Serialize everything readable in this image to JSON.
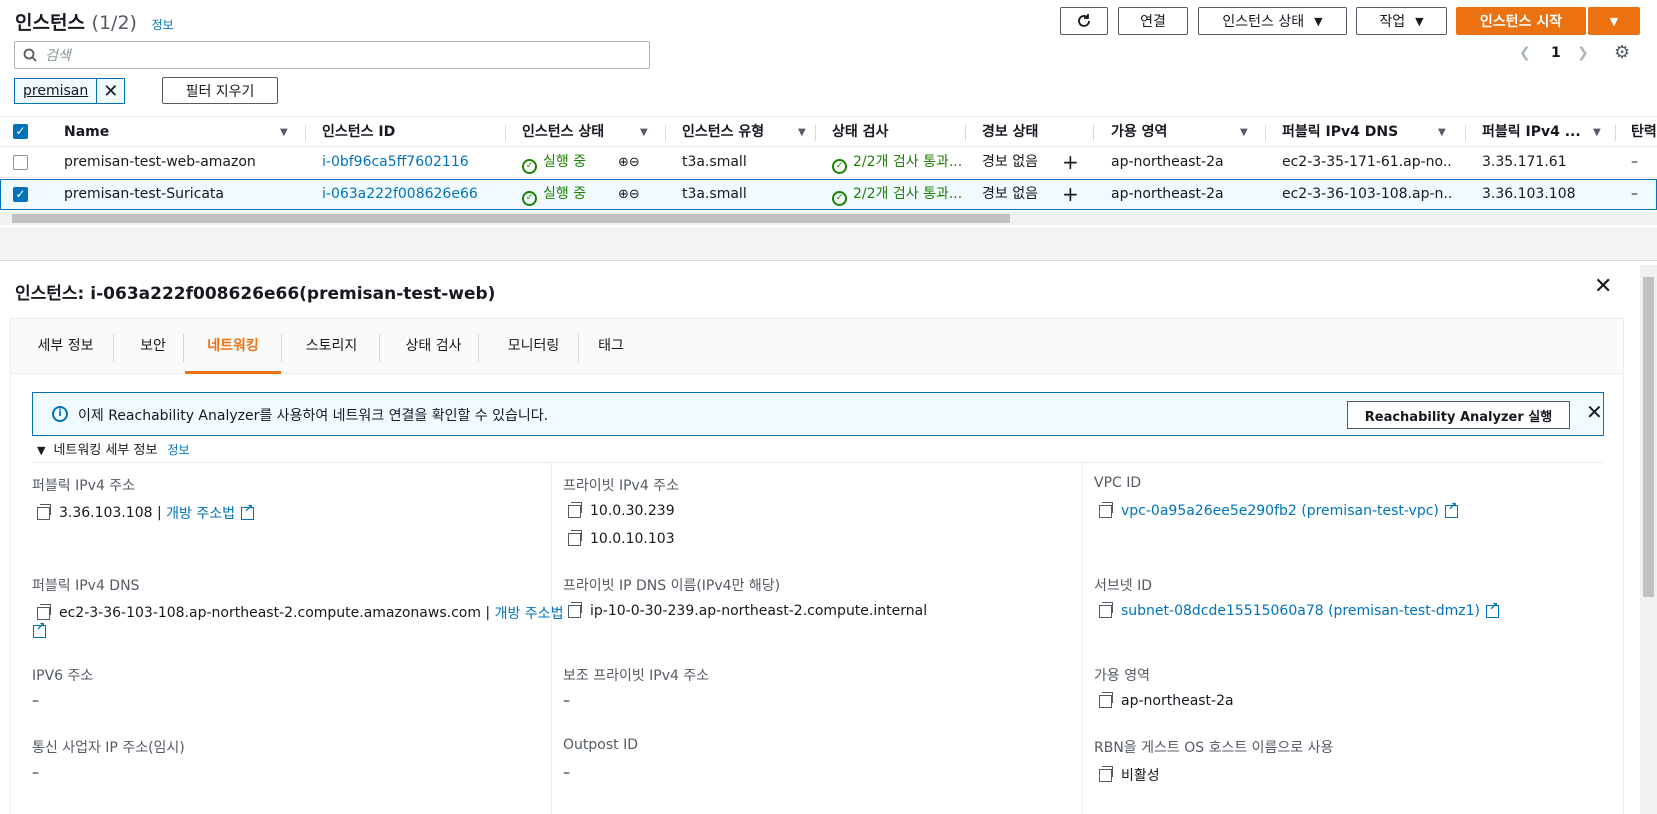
{
  "header": {
    "title": "인스턴스",
    "count": "(1/2)",
    "info": "정보",
    "buttons": {
      "connect": "연결",
      "instance_state": "인스턴스 상태",
      "actions": "작업",
      "launch": "인스턴스 시작"
    },
    "search_placeholder": "검색",
    "filter_token": "premisan",
    "clear_filters": "필터 지우기",
    "page": "1"
  },
  "table": {
    "columns": [
      "Name",
      "인스턴스 ID",
      "인스턴스 상태",
      "인스턴스 유형",
      "상태 검사",
      "경보 상태",
      "가용 영역",
      "퍼블릭 IPv4 DNS",
      "퍼블릭 IPv4 ...",
      "탄력"
    ],
    "rows": [
      {
        "selected": false,
        "name": "premisan-test-web-amazon",
        "id": "i-0bf96ca5ff7602116",
        "state": "실행 중",
        "type": "t3a.small",
        "check": "2/2개 검사 통과...",
        "alarm": "경보 없음",
        "az": "ap-northeast-2a",
        "dns": "ec2-3-35-171-61.ap-no...",
        "ip": "3.35.171.61",
        "elastic": "–"
      },
      {
        "selected": true,
        "name": "premisan-test-Suricata",
        "id": "i-063a222f008626e66",
        "state": "실행 중",
        "type": "t3a.small",
        "check": "2/2개 검사 통과...",
        "alarm": "경보 없음",
        "az": "ap-northeast-2a",
        "dns": "ec2-3-36-103-108.ap-n...",
        "ip": "3.36.103.108",
        "elastic": "–"
      }
    ]
  },
  "detail": {
    "title": "인스턴스: i-063a222f008626e66(premisan-test-web)",
    "tabs": [
      "세부 정보",
      "보안",
      "네트워킹",
      "스토리지",
      "상태 검사",
      "모니터링",
      "태그"
    ],
    "active_tab": "네트워킹",
    "alert": {
      "message": "이제 Reachability Analyzer를 사용하여 네트워크 연결을 확인할 수 있습니다.",
      "button": "Reachability Analyzer 실행"
    },
    "section": {
      "title": "네트워킹 세부 정보",
      "info": "정보"
    },
    "fields": {
      "public_ipv4_label": "퍼블릭 IPv4 주소",
      "public_ipv4_value": "3.36.103.108 |",
      "open_address": "개방 주소법",
      "private_ipv4_label": "프라이빗 IPv4 주소",
      "private_ipv4_1": "10.0.30.239",
      "private_ipv4_2": "10.0.10.103",
      "vpc_label": "VPC ID",
      "vpc_value": "vpc-0a95a26ee5e290fb2 (premisan-test-vpc)",
      "public_dns_label": "퍼블릭 IPv4 DNS",
      "public_dns_value": "ec2-3-36-103-108.ap-northeast-2.compute.amazonaws.com |",
      "public_dns_open": "개방 주소법",
      "private_dns_label": "프라이빗 IP DNS 이름(IPv4만 해당)",
      "private_dns_value": "ip-10-0-30-239.ap-northeast-2.compute.internal",
      "subnet_label": "서브넷 ID",
      "subnet_value": "subnet-08dcde15515060a78 (premisan-test-dmz1)",
      "ipv6_label": "IPV6 주소",
      "ipv6_value": "–",
      "secondary_private_label": "보조 프라이빗 IPv4 주소",
      "secondary_private_value": "–",
      "az_label": "가용 영역",
      "az_value": "ap-northeast-2a",
      "carrier_label": "통신 사업자 IP 주소(임시)",
      "carrier_value": "–",
      "outpost_label": "Outpost ID",
      "outpost_value": "–",
      "rbn_label": "RBN을 게스트 OS 호스트 이름으로 사용",
      "rbn_value": "비활성"
    }
  },
  "colors": {
    "accent": "#ec7211",
    "link": "#0073bb",
    "success": "#1d8102"
  }
}
